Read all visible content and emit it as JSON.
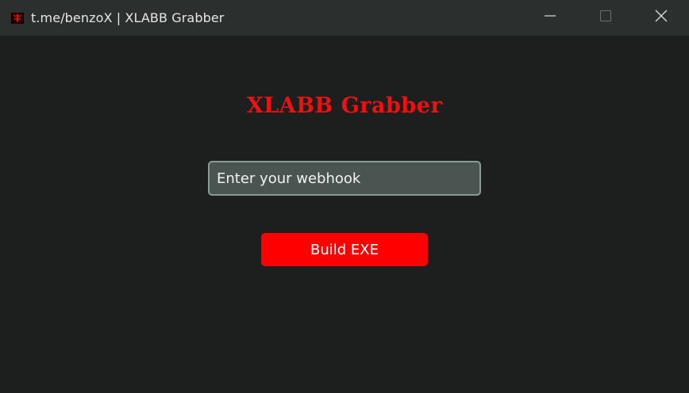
{
  "window": {
    "title": "t.me/benzoX | XLABB Grabber",
    "app_icon": "red-skull-icon",
    "controls": {
      "minimize_icon": "minimize-icon",
      "maximize_icon": "maximize-icon",
      "close_icon": "close-icon"
    }
  },
  "main": {
    "heading": "XLABB Grabber",
    "webhook_input": {
      "value": "",
      "placeholder": "Enter your webhook"
    },
    "build_button_label": "Build EXE"
  },
  "colors": {
    "background": "#1c1f1d",
    "titlebar": "#2b2f2d",
    "accent_red": "#ff0000",
    "heading_red": "#ee1111",
    "input_bg": "#4a5552",
    "input_border": "#8a9a96"
  }
}
